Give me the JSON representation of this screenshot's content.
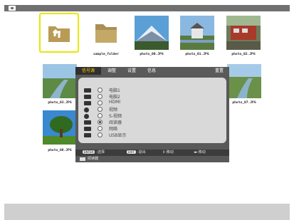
{
  "files": [
    {
      "caption": "..",
      "icon": "return-folder-icon",
      "selected": true
    },
    {
      "caption": "sample_folder",
      "icon": "folder-icon"
    },
    {
      "caption": "photo_00.JPG",
      "icon": "photo-mountain-icon"
    },
    {
      "caption": "photo_01.JPG",
      "icon": "photo-castle-icon"
    },
    {
      "caption": "photo_02.JPG",
      "icon": "photo-train-icon"
    },
    {
      "caption": "photo_03.JPG",
      "icon": "photo-river-icon"
    },
    {
      "caption": "photo_07.JPG",
      "icon": "photo-river-icon"
    },
    {
      "caption": "photo_08.JPG",
      "icon": "photo-tree-icon"
    }
  ],
  "dialog": {
    "tabs": [
      "信号源",
      "调整",
      "设置",
      "信息"
    ],
    "active_tab": "信号源",
    "reset_label": "重置",
    "options": [
      {
        "label": "电脑1",
        "icon": "computer-input-icon",
        "selected": false
      },
      {
        "label": "电脑2",
        "icon": "computer-input-icon",
        "selected": false
      },
      {
        "label": "HDMI",
        "icon": "hdmi-input-icon",
        "selected": false
      },
      {
        "label": "视频",
        "icon": "video-input-icon",
        "selected": false
      },
      {
        "label": "S-视频",
        "icon": "s-video-input-icon",
        "selected": false
      },
      {
        "label": "阅读器",
        "icon": "viewer-input-icon",
        "selected": true
      },
      {
        "label": "网络",
        "icon": "network-input-icon",
        "selected": false
      },
      {
        "label": "USB显示",
        "icon": "usb-display-input-icon",
        "selected": false
      }
    ],
    "hints": [
      {
        "key": "ENTER",
        "text": ":选择"
      },
      {
        "key": "EXIT",
        "text": ":退出"
      },
      {
        "key": "",
        "text": "⇕:移动"
      },
      {
        "key": "",
        "text": "◂▸:移动"
      }
    ],
    "footer_text": "阅读器"
  },
  "colors": {
    "accent": "#ffcc00",
    "selection": "#e8e800"
  }
}
